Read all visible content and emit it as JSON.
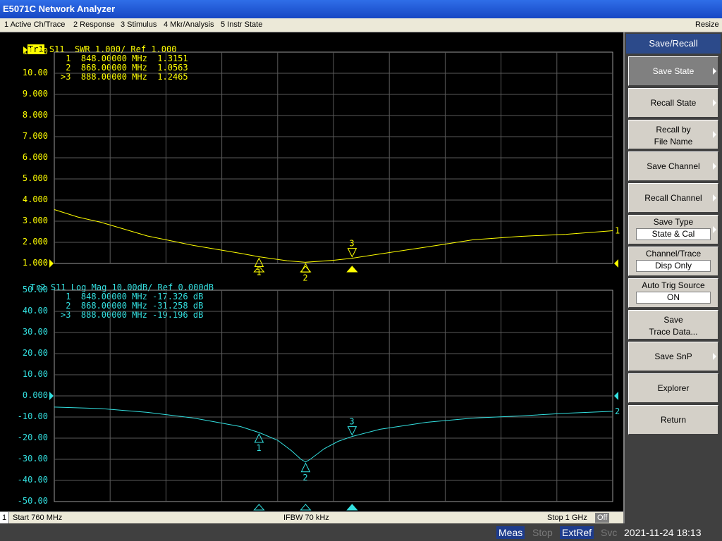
{
  "window": {
    "title": "E5071C Network Analyzer"
  },
  "menu": {
    "items": [
      "1 Active Ch/Trace",
      "2 Response",
      "3 Stimulus",
      "4 Mkr/Analysis",
      "5 Instr State"
    ],
    "resize": "Resize"
  },
  "trace1": {
    "label": "Tr1",
    "header": "S11  SWR 1.000/ Ref 1.000",
    "y_ticks": [
      "11.00",
      "10.00",
      "9.000",
      "8.000",
      "7.000",
      "6.000",
      "5.000",
      "4.000",
      "3.000",
      "2.000",
      "1.000"
    ],
    "markers": [
      " 1  848.00000 MHz  1.3151",
      " 2  868.00000 MHz  1.0563",
      ">3  888.00000 MHz  1.2465"
    ],
    "color": "#ffff00"
  },
  "trace2": {
    "label": "Tr2",
    "header": "S11 Log Mag 10.00dB/ Ref 0.000dB",
    "y_ticks": [
      "50.00",
      "40.00",
      "30.00",
      "20.00",
      "10.00",
      "0.000",
      "-10.00",
      "-20.00",
      "-30.00",
      "-40.00",
      "-50.00"
    ],
    "markers": [
      " 1  848.00000 MHz -17.326 dB",
      " 2  868.00000 MHz -31.258 dB",
      ">3  888.00000 MHz -19.196 dB"
    ],
    "color": "#33e0e0"
  },
  "chart_data": [
    {
      "type": "line",
      "title": "Tr1 S11 SWR 1.000/ Ref 1.000",
      "xlim": [
        760,
        1000
      ],
      "ylim": [
        1,
        11
      ],
      "series": [
        {
          "name": "Tr1",
          "x": [
            760,
            770,
            780,
            800,
            820,
            840,
            848,
            860,
            868,
            880,
            888,
            900,
            920,
            940,
            960,
            980,
            1000
          ],
          "values": [
            3.55,
            3.2,
            2.95,
            2.3,
            1.85,
            1.48,
            1.3151,
            1.13,
            1.0563,
            1.15,
            1.2465,
            1.45,
            1.78,
            2.12,
            2.28,
            2.38,
            2.55
          ]
        }
      ],
      "markers": [
        {
          "id": "1",
          "x": 848,
          "y": 1.3151
        },
        {
          "id": "2",
          "x": 868,
          "y": 1.0563
        },
        {
          "id": "3",
          "x": 888,
          "y": 1.2465
        }
      ]
    },
    {
      "type": "line",
      "title": "Tr2 S11 Log Mag 10.00dB/ Ref 0.000dB",
      "xlim": [
        760,
        1000
      ],
      "ylim": [
        -50,
        50
      ],
      "series": [
        {
          "name": "Tr2",
          "x": [
            760,
            780,
            800,
            820,
            840,
            848,
            856,
            862,
            866,
            868,
            870,
            876,
            882,
            888,
            900,
            920,
            940,
            960,
            980,
            1000
          ],
          "values": [
            -5.3,
            -6,
            -7.8,
            -10.5,
            -14.5,
            -17.326,
            -21,
            -26,
            -30,
            -31.258,
            -30,
            -25,
            -21.5,
            -19.196,
            -15.8,
            -12.5,
            -10.5,
            -9.5,
            -8.2,
            -7.3
          ]
        }
      ],
      "markers": [
        {
          "id": "1",
          "x": 848,
          "y": -17.326
        },
        {
          "id": "2",
          "x": 868,
          "y": -31.258
        },
        {
          "id": "3",
          "x": 888,
          "y": -19.196
        }
      ]
    }
  ],
  "status": {
    "channel": "1",
    "start": "Start 760 MHz",
    "ifbw": "IFBW 70 kHz",
    "stop": "Stop 1 GHz",
    "off": "Off"
  },
  "indicators": {
    "meas": "Meas",
    "stop": "Stop",
    "extref": "ExtRef",
    "svc": "Svc",
    "datetime": "2021-11-24 18:13"
  },
  "softkeys": {
    "header": "Save/Recall",
    "save_state": "Save State",
    "recall_state": "Recall State",
    "recall_by_line1": "Recall by",
    "recall_by_line2": "File Name",
    "save_channel": "Save Channel",
    "recall_channel": "Recall Channel",
    "save_type": "Save Type",
    "save_type_value": "State & Cal",
    "channel_trace": "Channel/Trace",
    "channel_trace_value": "Disp Only",
    "auto_trig": "Auto Trig Source",
    "auto_trig_value": "ON",
    "save_trace_line1": "Save",
    "save_trace_line2": "Trace Data...",
    "save_snp": "Save SnP",
    "explorer": "Explorer",
    "return": "Return"
  }
}
